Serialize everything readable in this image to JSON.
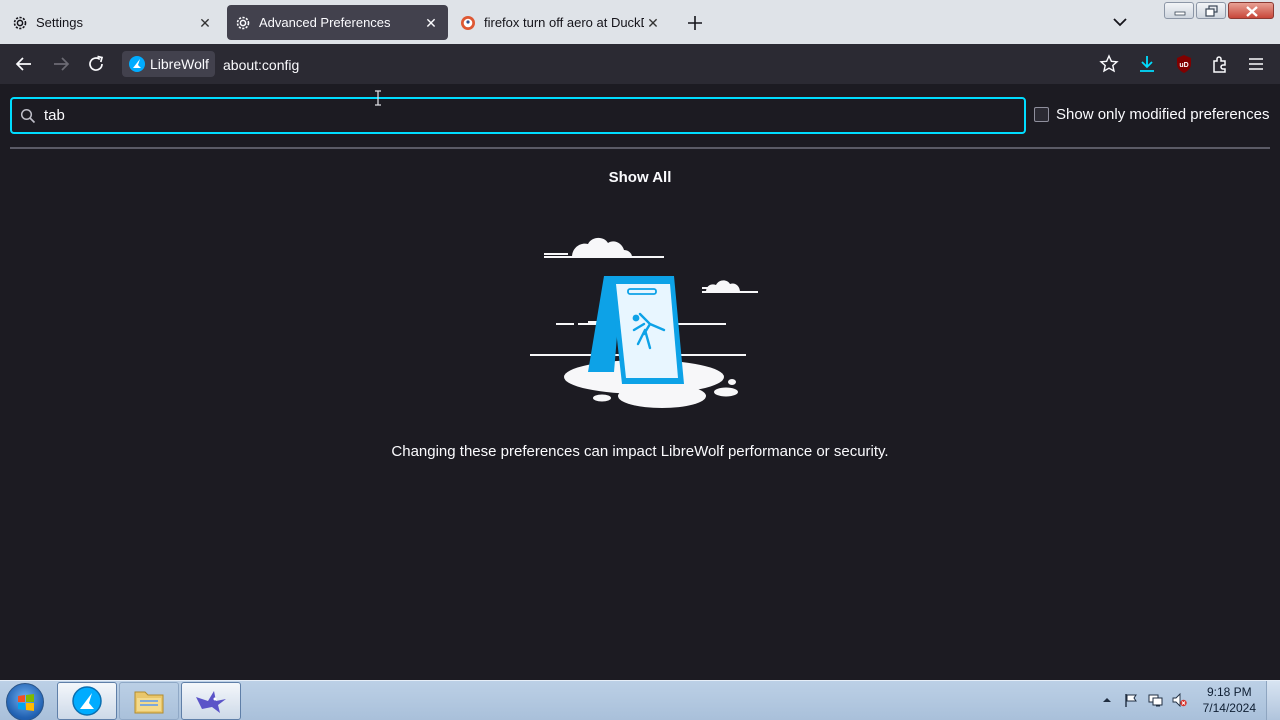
{
  "tabs": [
    {
      "label": "Settings",
      "icon": "gear-icon",
      "active": false
    },
    {
      "label": "Advanced Preferences",
      "icon": "gear-icon",
      "active": true
    },
    {
      "label": "firefox turn off aero at DuckDuc",
      "icon": "duckduckgo-icon",
      "active": false
    }
  ],
  "navbar": {
    "identity_label": "LibreWolf",
    "url": "about:config"
  },
  "config": {
    "search_value": "tab",
    "modified_label": "Show only modified preferences",
    "show_all": "Show All",
    "warning": "Changing these preferences can impact LibreWolf performance or security."
  },
  "taskbar": {
    "time": "9:18 PM",
    "date": "7/14/2024"
  },
  "colors": {
    "accent": "#00ddff",
    "page_bg": "#1c1b22",
    "toolbar_bg": "#2b2a33",
    "tabstrip_bg": "#dfe3e8"
  }
}
